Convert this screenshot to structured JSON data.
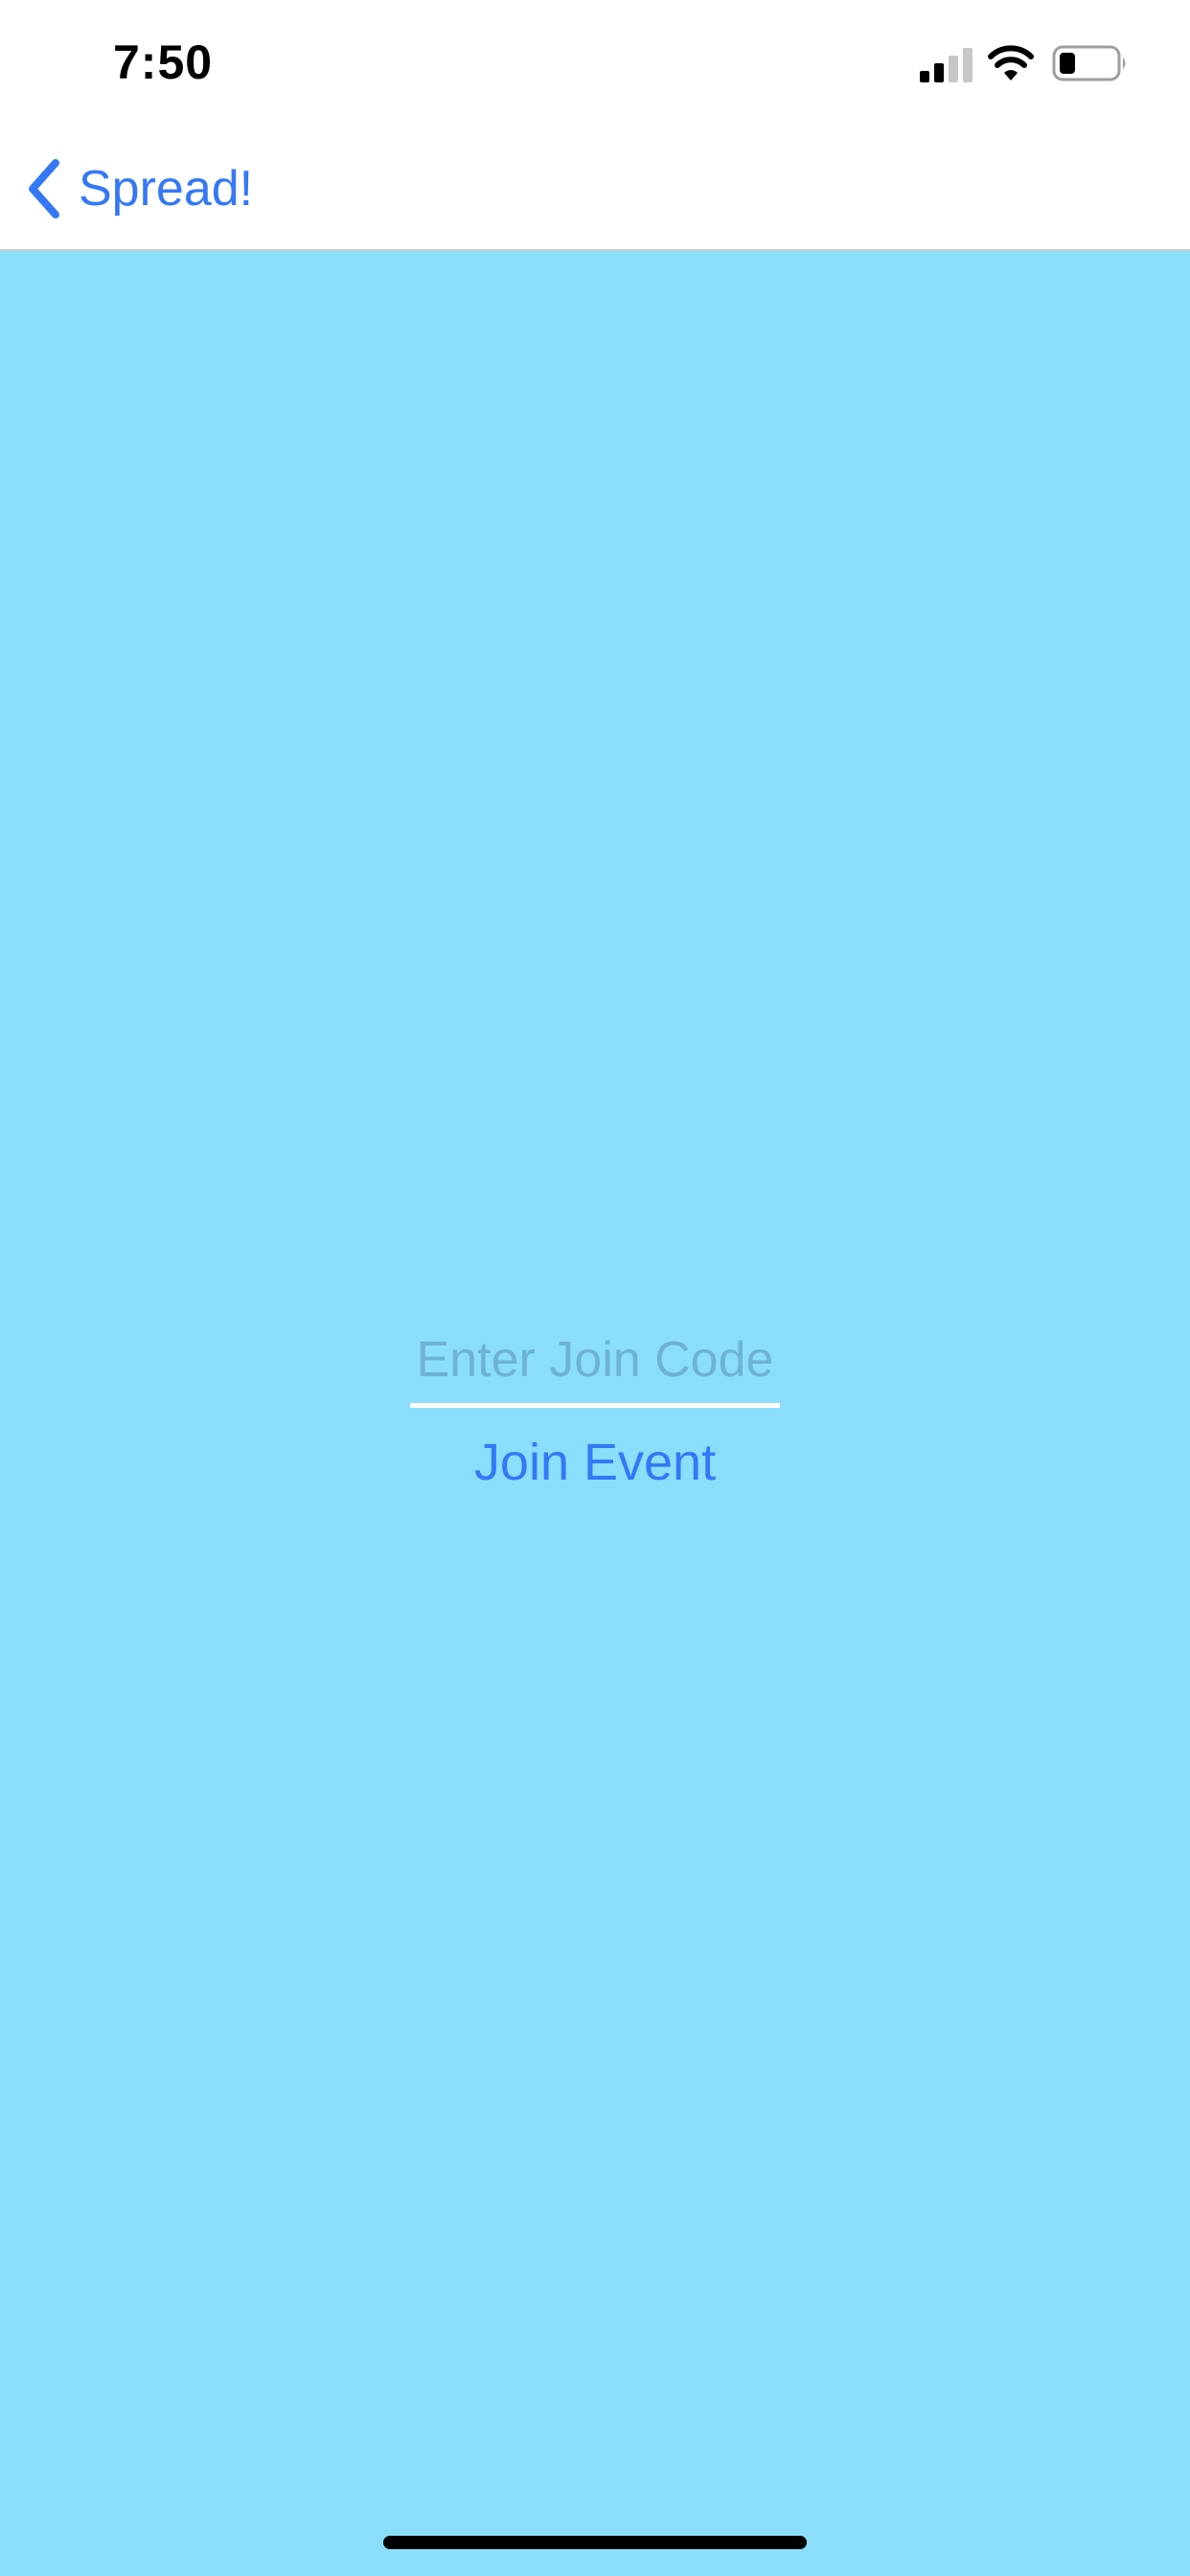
{
  "status_bar": {
    "time": "7:50",
    "icons": [
      "signal-icon",
      "wifi-icon",
      "battery-icon"
    ]
  },
  "nav_bar": {
    "back_label": "Spread!",
    "back_icon": "chevron-left-icon"
  },
  "join_form": {
    "code_value": "",
    "code_placeholder": "Enter Join Code",
    "join_button_label": "Join Event"
  },
  "colors": {
    "accent": "#3478f6",
    "background": "#8bdefa",
    "underline": "#ffffff"
  }
}
